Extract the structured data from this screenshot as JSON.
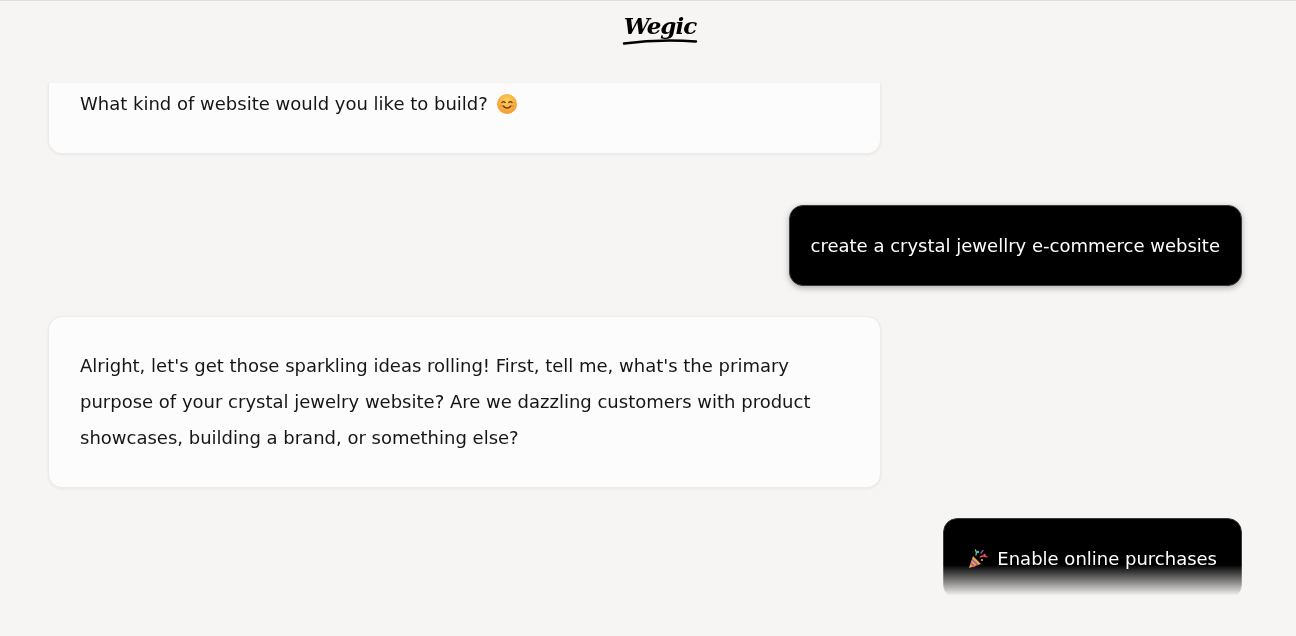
{
  "header": {
    "logo": "Wegic"
  },
  "messages": [
    {
      "kind": "assistant",
      "text": "What kind of website would you like to build?",
      "emoji": true
    },
    {
      "kind": "user",
      "text": "create a crystal jewellry e-commerce website"
    },
    {
      "kind": "assistant",
      "text": "Alright, let's get those sparkling ideas rolling! First, tell me, what's the primary purpose of your crystal jewelry website? Are we dazzling customers with product showcases, building a brand, or something else?"
    },
    {
      "kind": "option",
      "text": "Enable online purchases"
    }
  ]
}
